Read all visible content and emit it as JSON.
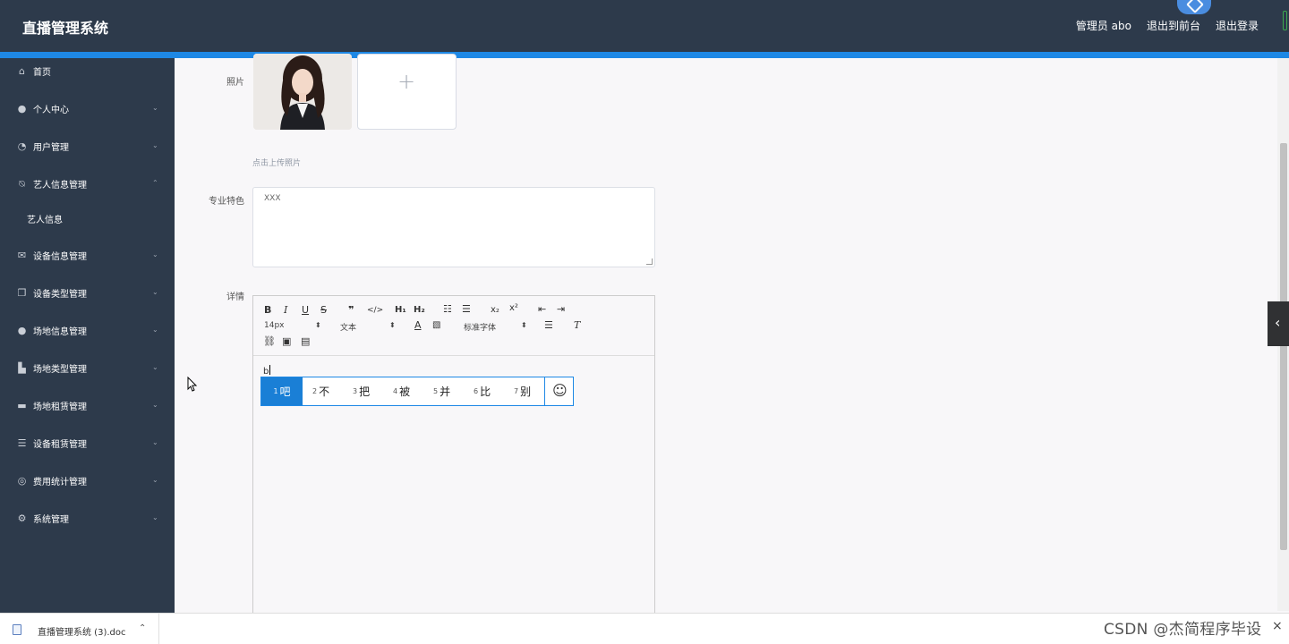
{
  "header": {
    "title": "直播管理系统",
    "admin": "管理员 abo",
    "exit_front": "退出到前台",
    "logout": "退出登录"
  },
  "sidebar": {
    "items": [
      {
        "label": "首页",
        "icon": "home-icon"
      },
      {
        "label": "个人中心",
        "icon": "user-icon"
      },
      {
        "label": "用户管理",
        "icon": "gauge-icon"
      },
      {
        "label": "艺人信息管理",
        "icon": "bell-off-icon"
      },
      {
        "label": "艺人信息",
        "icon": ""
      },
      {
        "label": "设备信息管理",
        "icon": "mail-icon"
      },
      {
        "label": "设备类型管理",
        "icon": "copy-icon"
      },
      {
        "label": "场地信息管理",
        "icon": "user-icon"
      },
      {
        "label": "场地类型管理",
        "icon": "truck-icon"
      },
      {
        "label": "场地租赁管理",
        "icon": "box-icon"
      },
      {
        "label": "设备租赁管理",
        "icon": "list-icon"
      },
      {
        "label": "费用统计管理",
        "icon": "circle-icon"
      },
      {
        "label": "系统管理",
        "icon": "settings-icon"
      }
    ]
  },
  "form": {
    "photo_label": "照片",
    "upload_hint": "点击上传照片",
    "specialty_label": "专业特色",
    "specialty_value": "XXX",
    "detail_label": "详情"
  },
  "editor": {
    "font_size": "14px",
    "text_type": "文本",
    "font_family": "标准字体",
    "typed": "b"
  },
  "ime": {
    "candidates": [
      {
        "num": "1",
        "text": "吧"
      },
      {
        "num": "2",
        "text": "不"
      },
      {
        "num": "3",
        "text": "把"
      },
      {
        "num": "4",
        "text": "被"
      },
      {
        "num": "5",
        "text": "并"
      },
      {
        "num": "6",
        "text": "比"
      },
      {
        "num": "7",
        "text": "别"
      }
    ]
  },
  "download_bar": {
    "file_name": "直播管理系统 (3).doc",
    "watermark": "CSDN @杰简程序毕设"
  }
}
